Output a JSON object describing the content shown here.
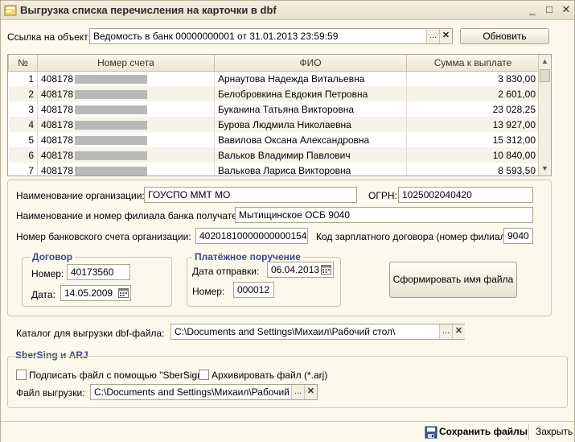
{
  "window": {
    "title": "Выгрузка списка перечисления на карточки в dbf",
    "controls": [
      "_",
      "□",
      "✕"
    ]
  },
  "link": {
    "label": "Ссылка на объект:",
    "value": "Ведомость в банк 00000000001 от 31.01.2013 23:59:59",
    "refresh_label": "Обновить"
  },
  "table": {
    "headers": [
      "№",
      "Номер счета",
      "ФИО",
      "Сумма к выплате"
    ],
    "rows": [
      {
        "n": "1",
        "acct": "408178",
        "fio": "Арнаутова Надежда Витальевна",
        "sum": "3 830,00"
      },
      {
        "n": "2",
        "acct": "408178",
        "fio": "Белобровкина Евдокия Петровна",
        "sum": "2 601,00"
      },
      {
        "n": "3",
        "acct": "408178",
        "fio": "Буканина Татьяна Викторовна",
        "sum": "23 028,25"
      },
      {
        "n": "4",
        "acct": "408178",
        "fio": "Бурова Людмила Николаевна",
        "sum": "13 927,00"
      },
      {
        "n": "5",
        "acct": "408178",
        "fio": "Вавилова Оксана Александровна",
        "sum": "15 312,00"
      },
      {
        "n": "6",
        "acct": "408178",
        "fio": "Вальков Владимир Павлович",
        "sum": "10 840,00"
      },
      {
        "n": "7",
        "acct": "408178",
        "fio": "Валькова Лариса Викторовна",
        "sum": "8 593,50"
      }
    ]
  },
  "org": {
    "name_label": "Наименование организации:",
    "name_value": "ГОУСПО ММТ МО",
    "ogrn_label": "ОГРН:",
    "ogrn_value": "1025002040420",
    "branch_label": "Наименование и номер филиала банка получателя:",
    "branch_value": "Мытищинское ОСБ 9040",
    "account_label": "Номер банковского счета организации:",
    "account_value": "40201810000000000154",
    "salary_label": "Код зарплатного договора (номер филиала):",
    "salary_value": "9040"
  },
  "contract": {
    "title": "Договор",
    "number_label": "Номер:",
    "number_value": "40173560",
    "date_label": "Дата:",
    "date_value": "14.05.2009"
  },
  "payment": {
    "title": "Платёжное поручение",
    "date_label": "Дата отправки:",
    "date_value": "06.04.2013",
    "number_label": "Номер:",
    "number_value": "000012"
  },
  "form_file_button": "Сформировать имя файла",
  "catalog": {
    "label": "Каталог для выгрузки dbf-файла:",
    "value": "C:\\Documents and Settings\\Михаил\\Рабочий стол\\"
  },
  "sber": {
    "title": "SberSing и ARJ",
    "sign_label": "Подписать файл с помощью \"SberSign\"",
    "archive_label": "Архивировать файл (*.arj)",
    "file_label": "Файл выгрузки:",
    "file_value": "C:\\Documents and Settings\\Михаил\\Рабочий стол\\"
  },
  "footer": {
    "save_label": "Сохранить файлы",
    "close_label": "Закрыть"
  },
  "icons": {
    "select": "...",
    "clear": "✕",
    "calendar": "calendar-icon",
    "save": "save-icon"
  }
}
